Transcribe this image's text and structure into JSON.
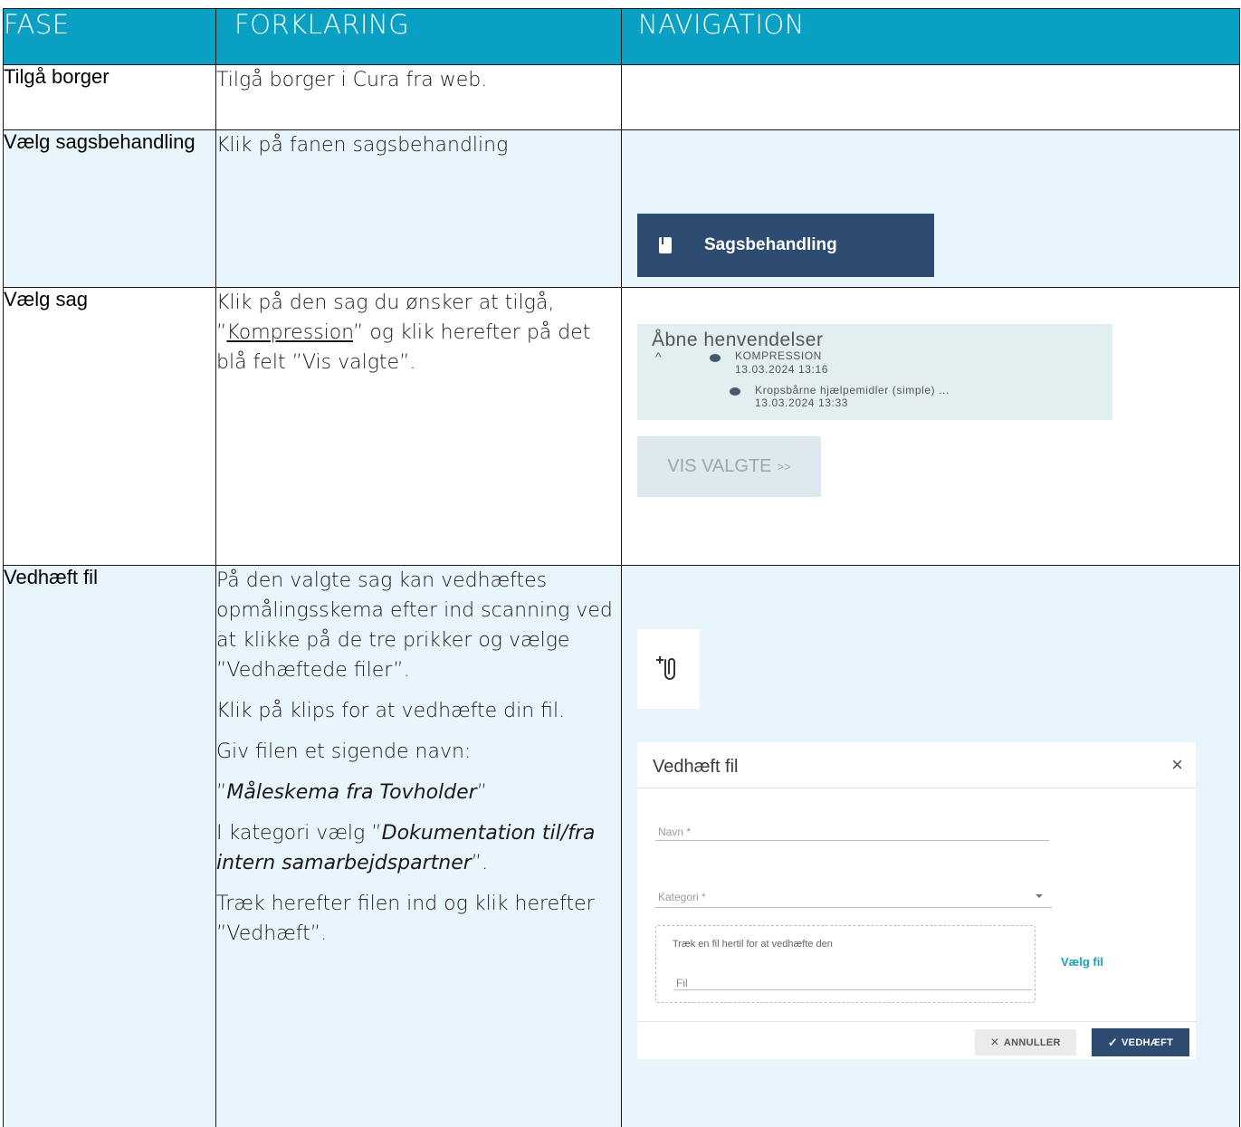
{
  "headers": {
    "fase": "FASE",
    "forklaring": "FORKLARING",
    "navigation": "NAVIGATION"
  },
  "rows": [
    {
      "phase": "Tilgå borger",
      "explanation": "Tilgå borger i Cura fra web."
    },
    {
      "phase": "Vælg sagsbehandling",
      "explanation": "Klik på fanen sagsbehandling",
      "nav_button": "Sagsbehandling"
    },
    {
      "phase": "Vælg sag",
      "expl_a": "Klik på den sag du ønsker at tilgå, ”",
      "expl_link": "Kompression",
      "expl_b": "” og klik herefter på det blå felt ”Vis valgte”.",
      "panel": {
        "title": "Åbne henvendelser",
        "caret": "^",
        "item1_name": "KOMPRESSION",
        "item1_date": "13.03.2024 13:16",
        "item2_name": "Kropsbårne hjælpemidler (simple) ...",
        "item2_date": "13.03.2024 13:33"
      },
      "vis_button": "VIS VALGTE",
      "vis_suffix": ">>"
    },
    {
      "phase": "Vedhæft fil",
      "p1": "På den valgte sag kan vedhæftes opmålingsskema efter ind scanning ved at klikke på de tre prikker og vælge ”Vedhæftede filer”.",
      "p2": "Klik på klips for at vedhæfte din fil.",
      "p3": "Giv filen et sigende navn:",
      "p4_q1": "”",
      "p4_it": "Måleskema fra Tovholder",
      "p4_q2": "”",
      "p5_a": "I kategori vælg ”",
      "p5_it": "Dokumentation til/fra intern samarbejdspartner",
      "p5_b": "”.",
      "p6": "Træk herefter filen ind og klik herefter ”Vedhæft”.",
      "dialog": {
        "title": "Vedhæft fil",
        "close": "×",
        "name_label": "Navn *",
        "category_label": "Kategori *",
        "drop_text": "Træk en fil hertil for at vedhæfte den",
        "file_label": "Fil",
        "choose_file": "Vælg fil",
        "cancel": "ANNULLER",
        "cancel_icon": "×",
        "attach": "VEDHÆFT",
        "attach_icon": "✓"
      }
    }
  ]
}
